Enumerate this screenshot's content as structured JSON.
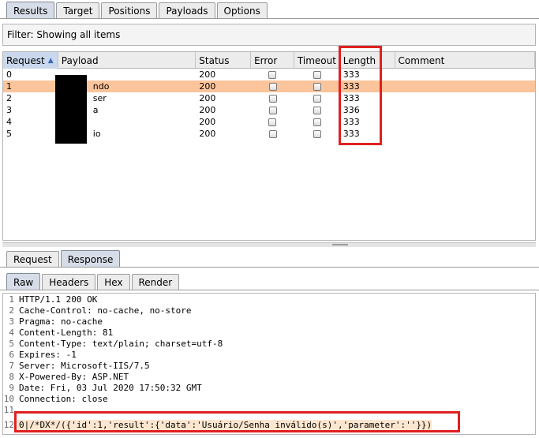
{
  "top_tabs": [
    "Results",
    "Target",
    "Positions",
    "Payloads",
    "Options"
  ],
  "filter": {
    "label": "Filter: Showing all items"
  },
  "table": {
    "headers": {
      "request": "Request",
      "payload": "Payload",
      "status": "Status",
      "error": "Error",
      "timeout": "Timeout",
      "length": "Length",
      "comment": "Comment"
    },
    "rows": [
      {
        "request": "0",
        "payload": "",
        "status": "200",
        "length": "333",
        "comment": ""
      },
      {
        "request": "1",
        "payload": "ndo",
        "status": "200",
        "length": "333",
        "comment": ""
      },
      {
        "request": "2",
        "payload": "ser",
        "status": "200",
        "length": "333",
        "comment": ""
      },
      {
        "request": "3",
        "payload": "a",
        "status": "200",
        "length": "336",
        "comment": ""
      },
      {
        "request": "4",
        "payload": "",
        "status": "200",
        "length": "333",
        "comment": ""
      },
      {
        "request": "5",
        "payload": "io",
        "status": "200",
        "length": "333",
        "comment": ""
      }
    ]
  },
  "rr_tabs": [
    "Request",
    "Response"
  ],
  "view_tabs": [
    "Raw",
    "Headers",
    "Hex",
    "Render"
  ],
  "response_lines": [
    {
      "n": "1",
      "text": "HTTP/1.1 200 OK"
    },
    {
      "n": "2",
      "text": "Cache-Control: no-cache, no-store"
    },
    {
      "n": "3",
      "text": "Pragma: no-cache"
    },
    {
      "n": "4",
      "text": "Content-Length: 81"
    },
    {
      "n": "5",
      "text": "Content-Type: text/plain; charset=utf-8"
    },
    {
      "n": "6",
      "text": "Expires: -1"
    },
    {
      "n": "7",
      "text": "Server: Microsoft-IIS/7.5"
    },
    {
      "n": "8",
      "text": "X-Powered-By: ASP.NET"
    },
    {
      "n": "9",
      "text": "Date: Fri, 03 Jul 2020 17:50:32 GMT"
    },
    {
      "n": "10",
      "text": "Connection: close"
    },
    {
      "n": "11",
      "text": ""
    },
    {
      "n": "12",
      "text": "0|/*DX*/({'id':1,'result':{'data':'Usuário/Senha inválido(s)','parameter':''}})"
    }
  ],
  "colors": {
    "selected_row": "#fbc49a",
    "highlight_box": "#e02020",
    "active_tab": "#d6dde8"
  }
}
